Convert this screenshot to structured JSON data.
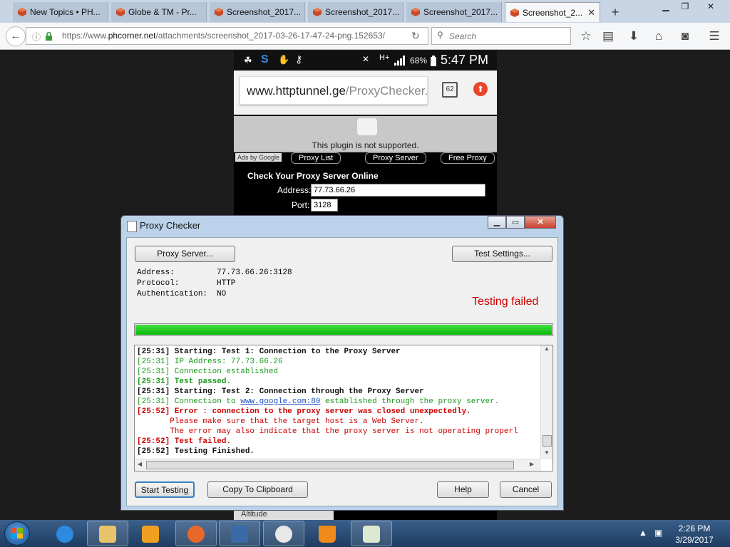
{
  "browser": {
    "tabs": [
      {
        "label": "New Topics • PH..."
      },
      {
        "label": "Globe & TM - Pr..."
      },
      {
        "label": "Screenshot_2017..."
      },
      {
        "label": "Screenshot_2017..."
      },
      {
        "label": "Screenshot_2017..."
      },
      {
        "label": "Screenshot_2...",
        "active": true
      }
    ],
    "new_tab": "+",
    "url_prefix": "https://www.",
    "url_domain": "phcorner.net",
    "url_path": "/attachments/screenshot_2017-03-26-17-47-24-png.152653/",
    "search_placeholder": "Search"
  },
  "phone": {
    "battery": "68%",
    "time": "5:47 PM",
    "url_domain": "www.httptunnel.ge",
    "url_path": "/ProxyChecker.a",
    "tab_count": "62",
    "plugin_msg": "This plugin is not supported.",
    "ads_label": "Ads by Google",
    "ad_links": [
      "Proxy List",
      "Proxy Server",
      "Free Proxy"
    ],
    "check_heading": "Check Your Proxy Server Online",
    "address_label": "Address:",
    "address_value": "77.73.66.26",
    "port_label": "Port:",
    "port_value": "3128",
    "footer_text": "Altitude"
  },
  "dialog": {
    "title": "Proxy Checker",
    "proxy_server_btn": "Proxy Server...",
    "test_settings_btn": "Test Settings...",
    "address_label": "Address:",
    "address_value": "77.73.66.26:3128",
    "protocol_label": "Protocol:",
    "protocol_value": "HTTP",
    "auth_label": "Authentication:",
    "auth_value": "NO",
    "status": "Testing failed",
    "progress": 1.0,
    "log": [
      {
        "text": "[25:31] Starting: Test 1: Connection to the Proxy Server",
        "style": "black"
      },
      {
        "text": "[25:31] IP Address: 77.73.66.26",
        "style": "green"
      },
      {
        "text": "[25:31] Connection established",
        "style": "green"
      },
      {
        "text": "[25:31] Test passed.",
        "style": "greenb"
      },
      {
        "text": "[25:31] Starting: Test 2: Connection through the Proxy Server",
        "style": "black"
      },
      {
        "text_pre": "[25:31] Connection to ",
        "link": "www.google.com:80",
        "text_post": " established through the proxy server.",
        "style": "green"
      },
      {
        "text": "[25:52] Error : connection to the proxy server was closed unexpectedly.",
        "style": "redb"
      },
      {
        "text": "       Please make sure that the target host is a Web Server.",
        "style": "red"
      },
      {
        "text": "       The error may also indicate that the proxy server is not operating properl",
        "style": "red"
      },
      {
        "text": "[25:52] Test failed.",
        "style": "redb"
      },
      {
        "text": "[25:52] Testing Finished.",
        "style": "black"
      }
    ],
    "start_btn": "Start Testing",
    "copy_btn": "Copy To Clipboard",
    "help_btn": "Help",
    "cancel_btn": "Cancel"
  },
  "taskbar": {
    "time": "2:26 PM",
    "date": "3/29/2017"
  },
  "colors": {
    "status_red": "#cc0000",
    "log_green": "#1a9a1a",
    "progress_green": "#08b808"
  }
}
